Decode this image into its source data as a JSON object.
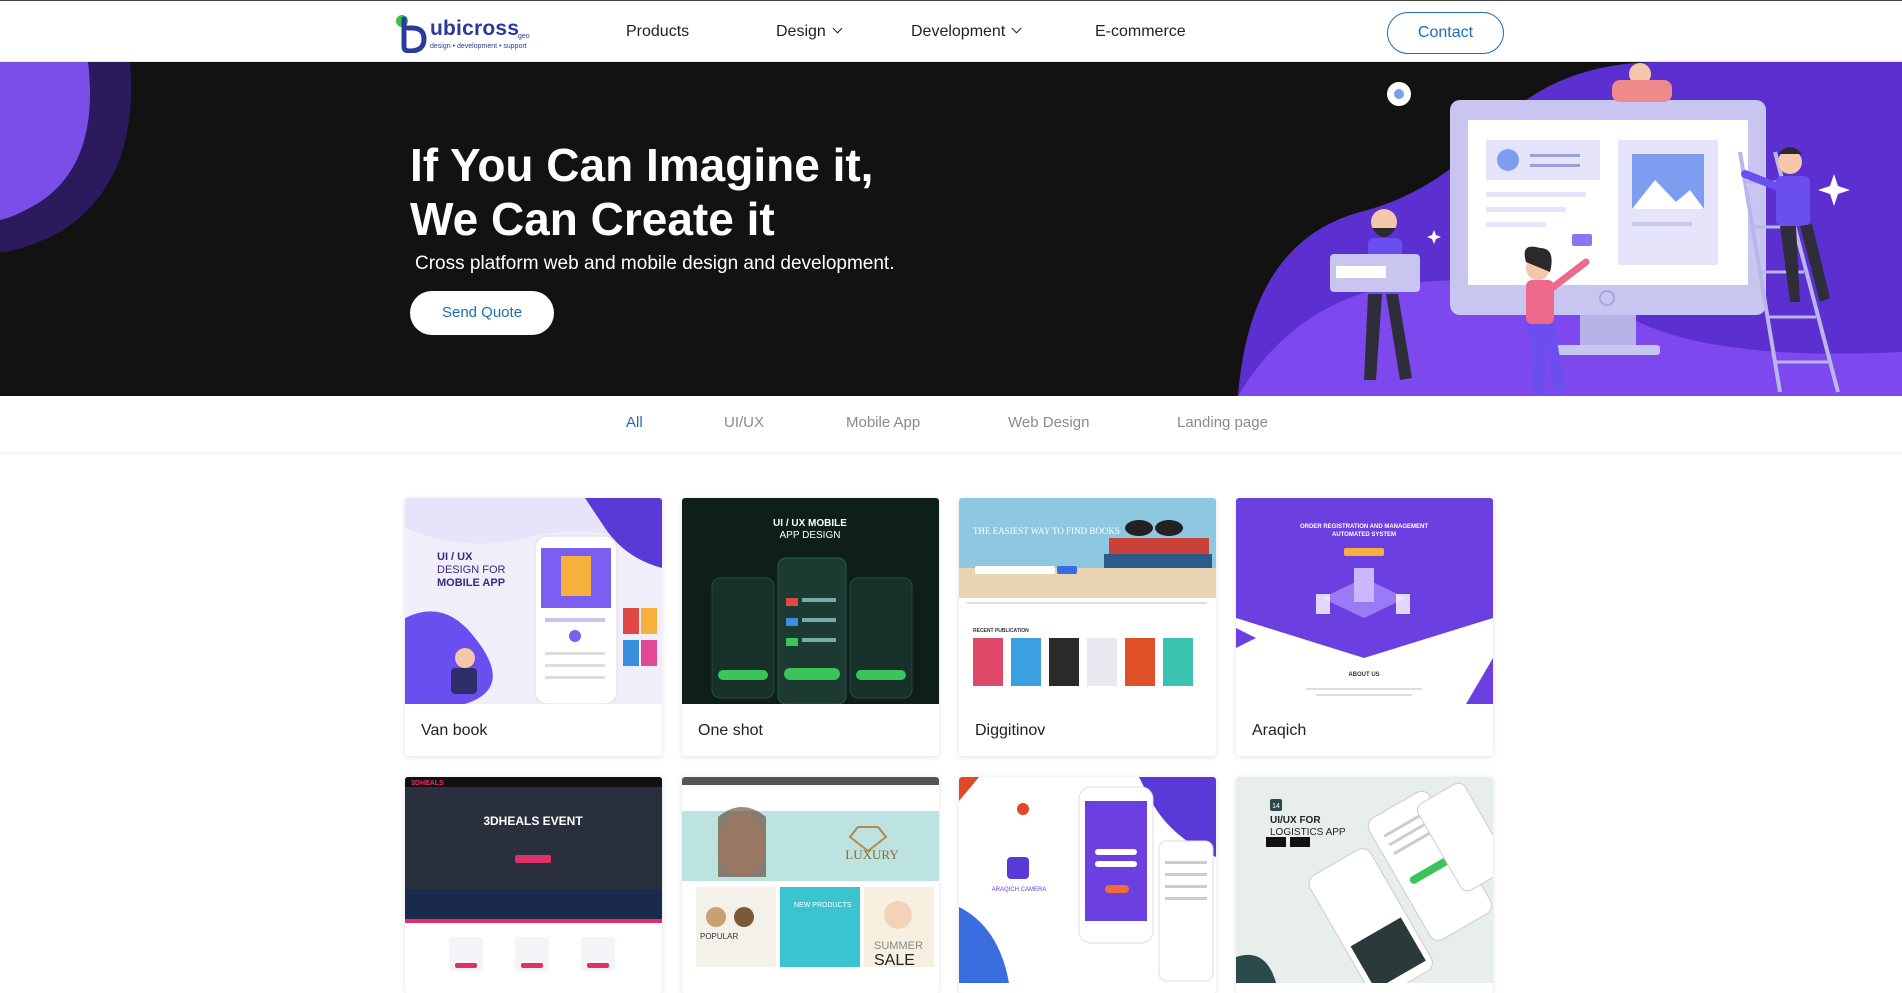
{
  "brand": {
    "name": "ubicross",
    "suffix": ".geo",
    "tagline": "design • development • support",
    "colors": {
      "primary": "#1e6bb3",
      "accent": "#6b3fe0",
      "dark": "#121212"
    }
  },
  "nav": {
    "items": [
      {
        "label": "Products"
      },
      {
        "label": "Design"
      },
      {
        "label": "Development"
      },
      {
        "label": "E-commerce"
      }
    ],
    "contact_label": "Contact"
  },
  "hero": {
    "title_line1": "If You Can Imagine it,",
    "title_line2": "We Can Create it",
    "subtitle": "Cross platform web and mobile design and development.",
    "cta_label": "Send Quote"
  },
  "filters": {
    "tabs": [
      {
        "label": "All",
        "active": true
      },
      {
        "label": "UI/UX",
        "active": false
      },
      {
        "label": "Mobile App",
        "active": false
      },
      {
        "label": "Web Design",
        "active": false
      },
      {
        "label": "Landing page",
        "active": false
      }
    ]
  },
  "portfolio": {
    "cards": [
      {
        "title": "Van book",
        "thumb": {
          "heading_line1": "UI / UX",
          "heading_line2": "DESIGN FOR",
          "heading_line3": "MOBILE APP"
        }
      },
      {
        "title": "One shot",
        "thumb": {
          "heading_line1": "UI / UX MOBILE",
          "heading_line2": "APP DESIGN"
        }
      },
      {
        "title": "Diggitinov",
        "thumb": {
          "heading": "THE EASIEST WAY TO FIND BOOKS",
          "section": "RECENT PUBLICATION"
        }
      },
      {
        "title": "Araqich",
        "thumb": {
          "heading_line1": "ORDER REGISTRATION AND MANAGEMENT",
          "heading_line2": "AUTOMATED SYSTEM",
          "section": "ABOUT US"
        }
      },
      {
        "title": "",
        "thumb": {
          "brand": "3DHEALS",
          "heading": "3DHEALS EVENT"
        }
      },
      {
        "title": "",
        "thumb": {
          "heading": "LUXURY",
          "badge1": "NEW PRODUCTS",
          "badge2": "POPULAR",
          "badge3": "SUMMER",
          "badge4": "SALE"
        }
      },
      {
        "title": "",
        "thumb": {
          "app": "ARAQICH CAMERA"
        }
      },
      {
        "title": "",
        "thumb": {
          "heading_line1": "UI/UX FOR",
          "heading_line2": "LOGISTICS APP",
          "number": "14"
        }
      }
    ]
  }
}
